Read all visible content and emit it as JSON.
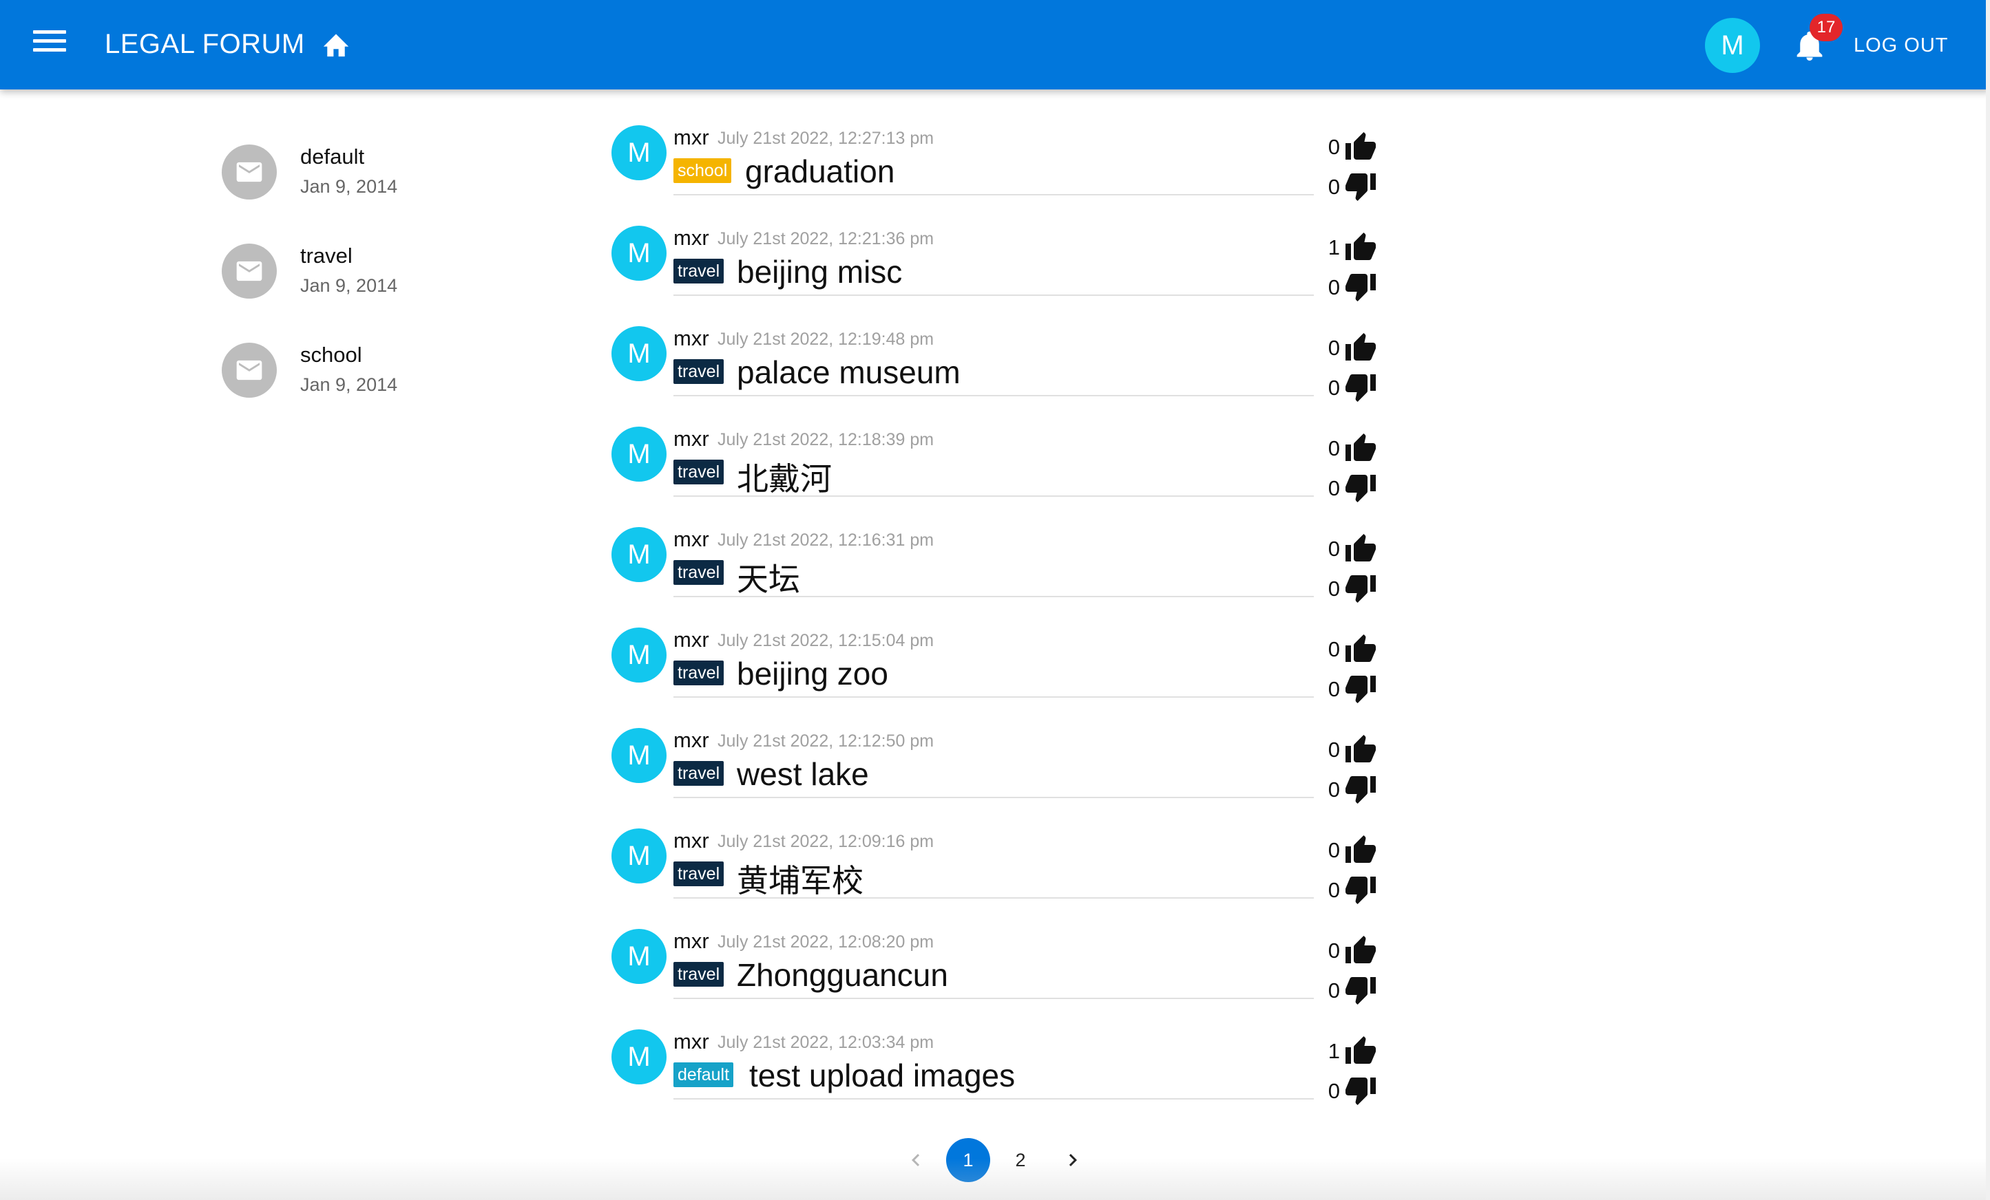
{
  "appbar": {
    "menu_icon": "menu-icon",
    "title": "LEGAL FORUM",
    "home_icon": "home-icon",
    "avatar_letter": "M",
    "notification_icon": "bell-icon",
    "notification_count": "17",
    "logout_label": "LOG OUT",
    "colors": {
      "bar": "#0177dc",
      "avatar": "#12c7ee",
      "badge": "#e3262a"
    }
  },
  "sidebar": {
    "items": [
      {
        "name": "default",
        "date": "Jan 9, 2014",
        "icon": "mail-icon"
      },
      {
        "name": "travel",
        "date": "Jan 9, 2014",
        "icon": "mail-icon"
      },
      {
        "name": "school",
        "date": "Jan 9, 2014",
        "icon": "mail-icon"
      }
    ]
  },
  "tag_colors": {
    "school": "#f5b400",
    "travel": "#0c2a44",
    "default": "#16a2c8"
  },
  "posts": [
    {
      "avatar": "M",
      "author": "mxr",
      "time": "July 21st 2022, 12:27:13 pm",
      "tag": "school",
      "title": "graduation",
      "up": "0",
      "down": "0"
    },
    {
      "avatar": "M",
      "author": "mxr",
      "time": "July 21st 2022, 12:21:36 pm",
      "tag": "travel",
      "title": "beijing misc",
      "up": "1",
      "down": "0"
    },
    {
      "avatar": "M",
      "author": "mxr",
      "time": "July 21st 2022, 12:19:48 pm",
      "tag": "travel",
      "title": "palace museum",
      "up": "0",
      "down": "0"
    },
    {
      "avatar": "M",
      "author": "mxr",
      "time": "July 21st 2022, 12:18:39 pm",
      "tag": "travel",
      "title": "北戴河",
      "up": "0",
      "down": "0"
    },
    {
      "avatar": "M",
      "author": "mxr",
      "time": "July 21st 2022, 12:16:31 pm",
      "tag": "travel",
      "title": "天坛",
      "up": "0",
      "down": "0"
    },
    {
      "avatar": "M",
      "author": "mxr",
      "time": "July 21st 2022, 12:15:04 pm",
      "tag": "travel",
      "title": "beijing zoo",
      "up": "0",
      "down": "0"
    },
    {
      "avatar": "M",
      "author": "mxr",
      "time": "July 21st 2022, 12:12:50 pm",
      "tag": "travel",
      "title": "west lake",
      "up": "0",
      "down": "0"
    },
    {
      "avatar": "M",
      "author": "mxr",
      "time": "July 21st 2022, 12:09:16 pm",
      "tag": "travel",
      "title": "黄埔军校",
      "up": "0",
      "down": "0"
    },
    {
      "avatar": "M",
      "author": "mxr",
      "time": "July 21st 2022, 12:08:20 pm",
      "tag": "travel",
      "title": "Zhongguancun",
      "up": "0",
      "down": "0"
    },
    {
      "avatar": "M",
      "author": "mxr",
      "time": "July 21st 2022, 12:03:34 pm",
      "tag": "default",
      "title": "test upload images",
      "up": "1",
      "down": "0"
    }
  ],
  "pagination": {
    "prev_icon": "chevron-left-icon",
    "pages": [
      "1",
      "2"
    ],
    "current": "1",
    "next_icon": "chevron-right-icon"
  }
}
